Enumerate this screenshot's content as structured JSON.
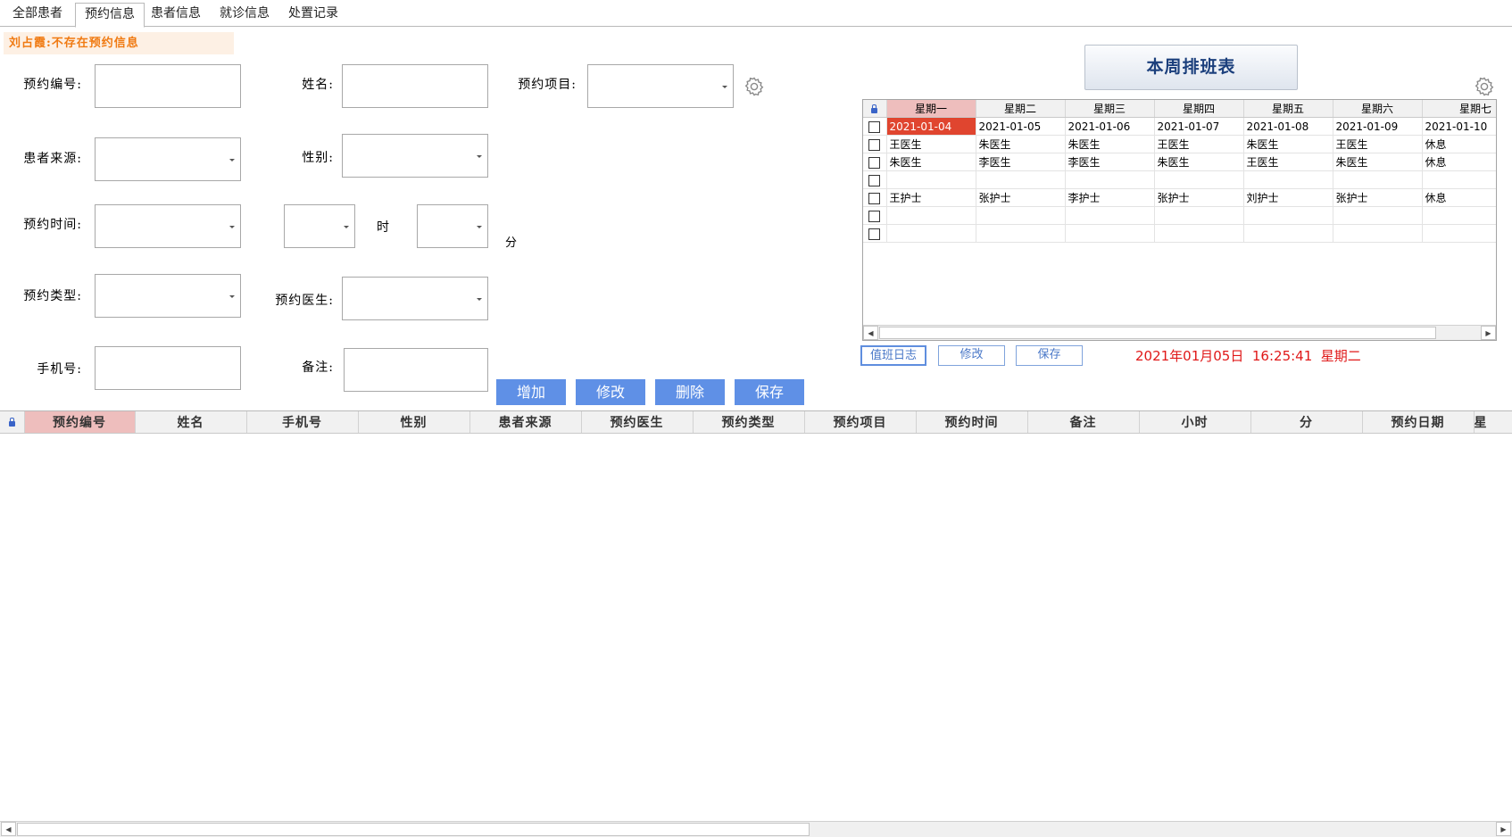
{
  "tabs": [
    {
      "label": "全部患者",
      "active": false
    },
    {
      "label": "预约信息",
      "active": true
    },
    {
      "label": "患者信息",
      "active": false
    },
    {
      "label": "就诊信息",
      "active": false
    },
    {
      "label": "处置记录",
      "active": false
    }
  ],
  "status_message": "刘占霞:不存在预约信息",
  "form": {
    "appointment_no_label": "预约编号:",
    "name_label": "姓名:",
    "item_label": "预约项目:",
    "source_label": "患者来源:",
    "gender_label": "性别:",
    "time_label": "预约时间:",
    "hour_label": "时",
    "minute_label": "分",
    "type_label": "预约类型:",
    "doctor_label": "预约医生:",
    "phone_label": "手机号:",
    "remark_label": "备注:"
  },
  "buttons": {
    "add": "增加",
    "edit": "修改",
    "delete": "删除",
    "save": "保存"
  },
  "schedule": {
    "title": "本周排班表",
    "headers": [
      "星期一",
      "星期二",
      "星期三",
      "星期四",
      "星期五",
      "星期六",
      "星期七"
    ],
    "rows": [
      [
        "2021-01-04",
        "2021-01-05",
        "2021-01-06",
        "2021-01-07",
        "2021-01-08",
        "2021-01-09",
        "2021-01-10"
      ],
      [
        "王医生",
        "朱医生",
        "朱医生",
        "王医生",
        "朱医生",
        "王医生",
        "休息"
      ],
      [
        "朱医生",
        "李医生",
        "李医生",
        "朱医生",
        "王医生",
        "朱医生",
        "休息"
      ],
      [
        "",
        "",
        "",
        "",
        "",
        "",
        ""
      ],
      [
        "王护士",
        "张护士",
        "李护士",
        "张护士",
        "刘护士",
        "张护士",
        "休息"
      ],
      [
        "",
        "",
        "",
        "",
        "",
        "",
        ""
      ],
      [
        "",
        "",
        "",
        "",
        "",
        "",
        ""
      ]
    ],
    "duty_log_button": "值班日志",
    "edit_button": "修改",
    "save_button": "保存"
  },
  "datetime": "2021年01月05日  16:25:41  星期二",
  "main_table": {
    "columns": [
      "预约编号",
      "姓名",
      "手机号",
      "性别",
      "患者来源",
      "预约医生",
      "预约类型",
      "预约项目",
      "预约时间",
      "备注",
      "小时",
      "分",
      "预约日期",
      "星"
    ]
  },
  "colors": {
    "accent_button": "#5f90e6",
    "status_text": "#f07a12",
    "clock_text": "#e01818",
    "selected_cell": "#e0452f",
    "selected_header": "#eebebd"
  }
}
